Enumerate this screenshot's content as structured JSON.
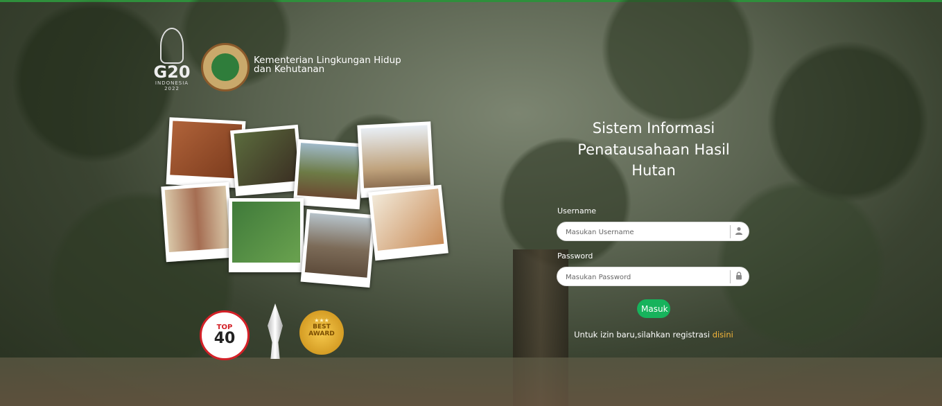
{
  "header": {
    "g20_text": "G20",
    "g20_sub": "INDONESIA",
    "g20_year": "2022",
    "ministry_name": "Kementerian Lingkungan Hidup dan Kehutanan"
  },
  "awards": {
    "top40_line1": "TOP",
    "top40_line2": "40",
    "medal_line1": "BEST",
    "medal_line2": "AWARD"
  },
  "login": {
    "title": "Sistem Informasi Penatausahaan Hasil Hutan",
    "username_label": "Username",
    "username_placeholder": "Masukan Username",
    "username_icon": "user-icon",
    "password_label": "Password",
    "password_placeholder": "Masukan Password",
    "password_icon": "lock-icon",
    "submit_label": "Masuk",
    "register_text": "Untuk izin baru,silahkan registrasi ",
    "register_link": "disini"
  },
  "colors": {
    "accent_green": "#17b35c",
    "link_orange": "#f4b53a",
    "top_bar": "#2f8f3c"
  }
}
